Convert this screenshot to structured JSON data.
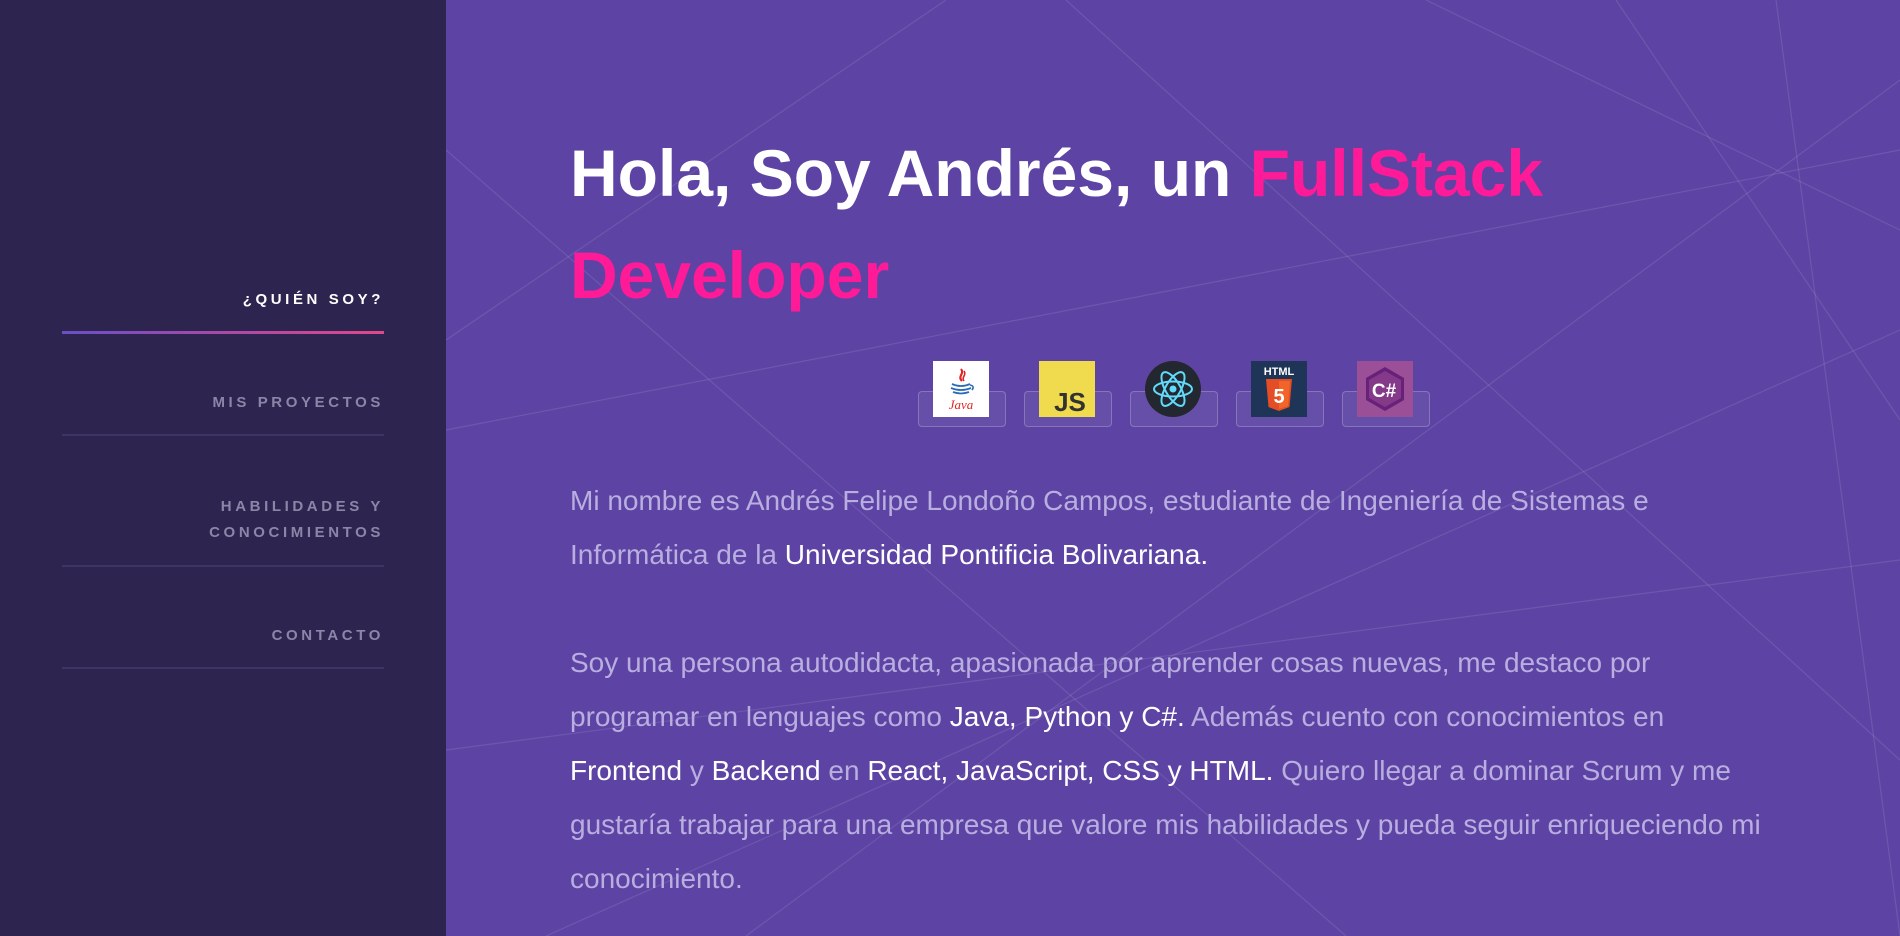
{
  "sidebar": {
    "items": [
      {
        "label": "¿QUIÉN SOY?",
        "active": true
      },
      {
        "label": "MIS PROYECTOS",
        "active": false
      },
      {
        "label_line1": "HABILIDADES Y",
        "label_line2": "CONOCIMIENTOS",
        "active": false
      },
      {
        "label": "CONTACTO",
        "active": false
      }
    ]
  },
  "hero": {
    "title_prefix": "Hola, Soy Andrés, un",
    "title_accent_1": "FullStack",
    "title_accent_2": "Developer"
  },
  "tech_icons": [
    {
      "name": "java-icon",
      "text": "Java"
    },
    {
      "name": "javascript-icon",
      "text": "JS"
    },
    {
      "name": "react-icon"
    },
    {
      "name": "html5-icon",
      "text": "HTML",
      "badge": "5"
    },
    {
      "name": "csharp-icon",
      "text": "C#"
    }
  ],
  "about": {
    "p1_a": "Mi nombre es Andrés Felipe Londoño Campos, estudiante de Ingeniería de Sistemas e Informática de la ",
    "p1_hl": "Universidad Pontificia Bolivariana.",
    "p2_a": "Soy una persona autodidacta, apasionada por aprender cosas nuevas, me destaco por programar en lenguajes como ",
    "p2_hl1": "Java, Python y C#.",
    "p2_b": " Además cuento con conocimientos en ",
    "p2_hl2": "Frontend",
    "p2_c": " y ",
    "p2_hl3": "Backend",
    "p2_d": " en ",
    "p2_hl4": "React, JavaScript, CSS y HTML.",
    "p2_e": " Quiero llegar a dominar Scrum y me gustaría trabajar para una empresa que valore mis habilidades y pueda seguir enriqueciendo mi conocimiento."
  },
  "colors": {
    "sidebar_bg": "#2e2450",
    "main_bg": "#5d44a4",
    "accent": "#ff1a98",
    "muted_text": "#b9aee0",
    "nav_muted": "#8d85a8"
  }
}
